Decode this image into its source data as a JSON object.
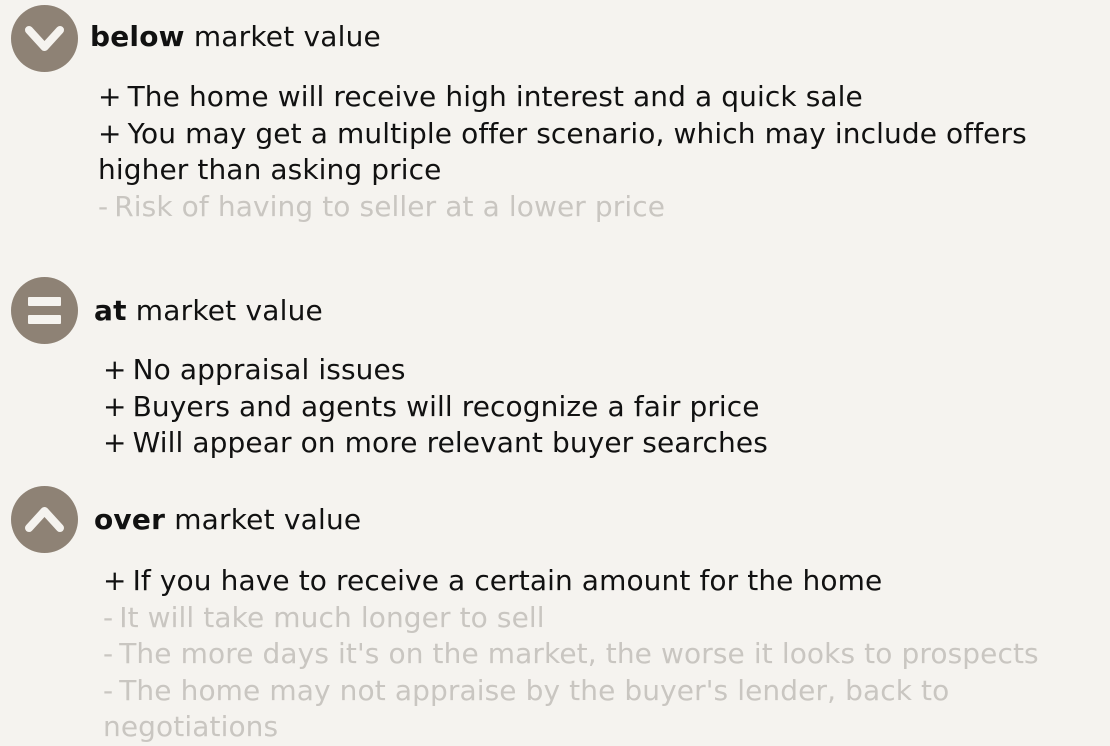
{
  "sections": [
    {
      "icon": "chevron-down-icon",
      "heading_bold": "below",
      "heading_rest": " market value",
      "items": [
        {
          "sign": "+",
          "text": "The home will receive high interest and a quick sale",
          "type": "pro"
        },
        {
          "sign": "+",
          "text": "You may get a multiple offer scenario, which may include offers higher than asking price",
          "type": "pro"
        },
        {
          "sign": "-",
          "text": "Risk of having to seller at a lower price",
          "type": "con"
        }
      ]
    },
    {
      "icon": "equals-icon",
      "heading_bold": "at",
      "heading_rest": " market value",
      "items": [
        {
          "sign": "+",
          "text": "No appraisal issues",
          "type": "pro"
        },
        {
          "sign": "+",
          "text": "Buyers and agents will recognize a fair price",
          "type": "pro"
        },
        {
          "sign": "+",
          "text": "Will appear on more relevant buyer searches",
          "type": "pro"
        }
      ]
    },
    {
      "icon": "chevron-up-icon",
      "heading_bold": "over",
      "heading_rest": " market value",
      "items": [
        {
          "sign": "+",
          "text": "If you have to receive a certain amount for the home",
          "type": "pro"
        },
        {
          "sign": "-",
          "text": "It will take much longer to sell",
          "type": "con"
        },
        {
          "sign": "-",
          "text": "The more days it's on the market, the worse it looks to prospects",
          "type": "con"
        },
        {
          "sign": "-",
          "text": "The home may not appraise by the buyer's lender, back to negotiations",
          "type": "con"
        }
      ]
    }
  ],
  "colors": {
    "background": "#f5f3ef",
    "icon_circle": "#8e8275",
    "icon_glyph": "#f5f3ef",
    "pro_text": "#111111",
    "con_text": "#c9c6c1"
  }
}
